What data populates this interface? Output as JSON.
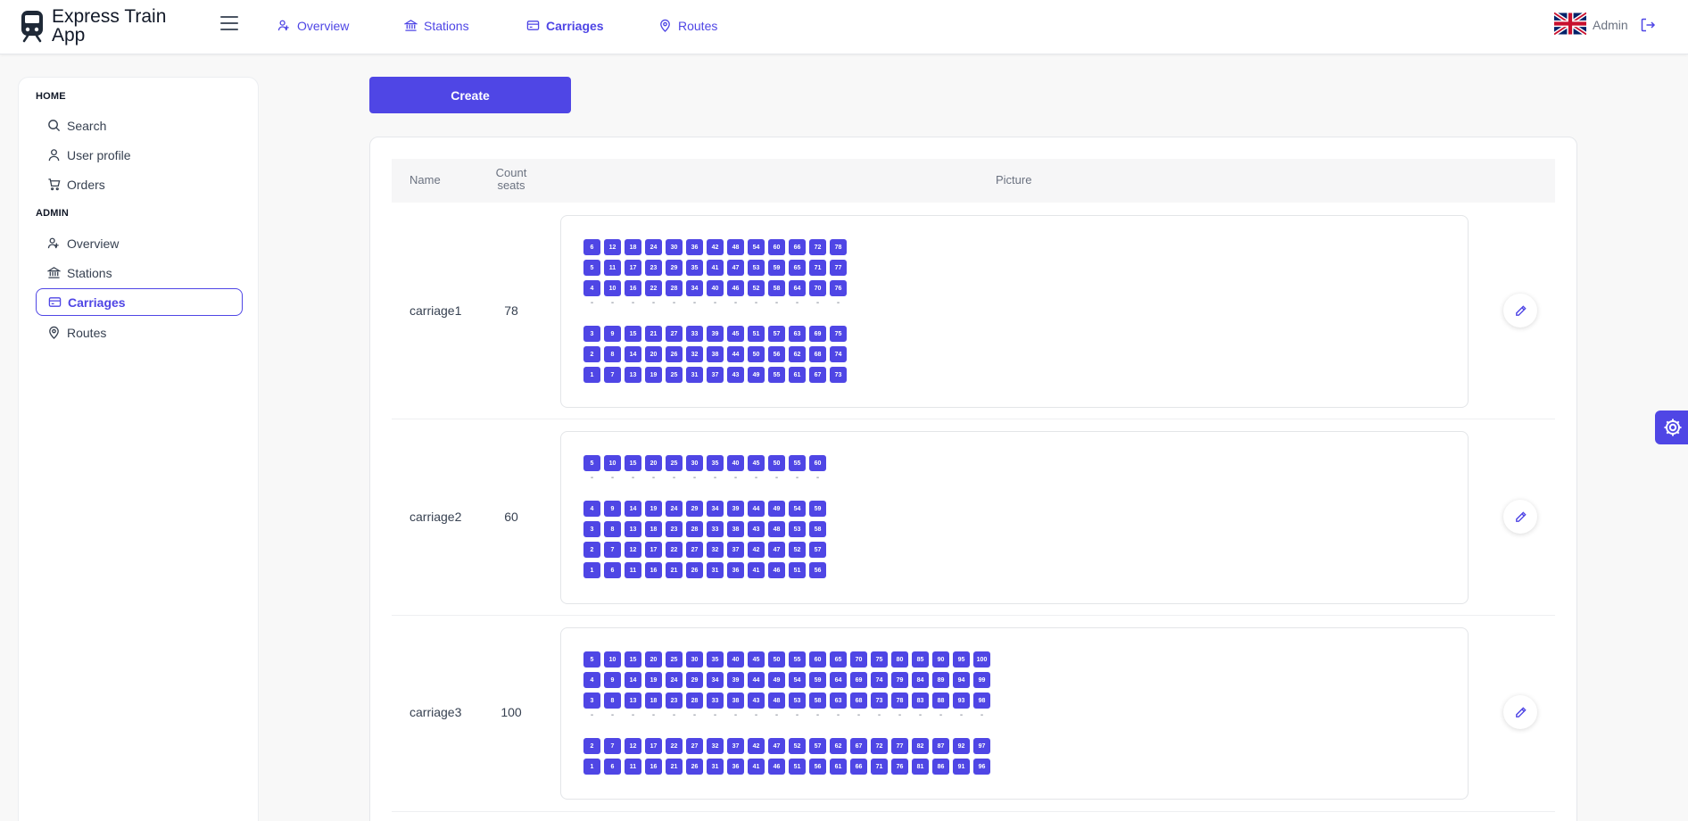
{
  "app": {
    "title": "Express Train App",
    "user": "Admin"
  },
  "nav": {
    "overview": "Overview",
    "stations": "Stations",
    "carriages": "Carriages",
    "routes": "Routes"
  },
  "sidebar": {
    "home_heading": "HOME",
    "search": "Search",
    "user_profile": "User profile",
    "orders": "Orders",
    "admin_heading": "ADMIN",
    "overview": "Overview",
    "stations": "Stations",
    "carriages": "Carriages",
    "routes": "Routes"
  },
  "main": {
    "create_label": "Create"
  },
  "table": {
    "columns": {
      "name": "Name",
      "count": "Count seats",
      "picture": "Picture"
    },
    "rows": [
      {
        "name": "carriage1",
        "count": "78",
        "seats_above": [
          [
            "6",
            "12",
            "18",
            "24",
            "30",
            "36",
            "42",
            "48",
            "54",
            "60",
            "66",
            "72",
            "78"
          ],
          [
            "5",
            "11",
            "17",
            "23",
            "29",
            "35",
            "41",
            "47",
            "53",
            "59",
            "65",
            "71",
            "77"
          ],
          [
            "4",
            "10",
            "16",
            "22",
            "28",
            "34",
            "40",
            "46",
            "52",
            "58",
            "64",
            "70",
            "76"
          ]
        ],
        "seats_below": [
          [
            "3",
            "9",
            "15",
            "21",
            "27",
            "33",
            "39",
            "45",
            "51",
            "57",
            "63",
            "69",
            "75"
          ],
          [
            "2",
            "8",
            "14",
            "20",
            "26",
            "32",
            "38",
            "44",
            "50",
            "56",
            "62",
            "68",
            "74"
          ],
          [
            "1",
            "7",
            "13",
            "19",
            "25",
            "31",
            "37",
            "43",
            "49",
            "55",
            "61",
            "67",
            "73"
          ]
        ]
      },
      {
        "name": "carriage2",
        "count": "60",
        "seats_above": [
          [
            "5",
            "10",
            "15",
            "20",
            "25",
            "30",
            "35",
            "40",
            "45",
            "50",
            "55",
            "60"
          ]
        ],
        "seats_below": [
          [
            "4",
            "9",
            "14",
            "19",
            "24",
            "29",
            "34",
            "39",
            "44",
            "49",
            "54",
            "59"
          ],
          [
            "3",
            "8",
            "13",
            "18",
            "23",
            "28",
            "33",
            "38",
            "43",
            "48",
            "53",
            "58"
          ],
          [
            "2",
            "7",
            "12",
            "17",
            "22",
            "27",
            "32",
            "37",
            "42",
            "47",
            "52",
            "57"
          ],
          [
            "1",
            "6",
            "11",
            "16",
            "21",
            "26",
            "31",
            "36",
            "41",
            "46",
            "51",
            "56"
          ]
        ]
      },
      {
        "name": "carriage3",
        "count": "100",
        "seats_above": [
          [
            "5",
            "10",
            "15",
            "20",
            "25",
            "30",
            "35",
            "40",
            "45",
            "50",
            "55",
            "60",
            "65",
            "70",
            "75",
            "80",
            "85",
            "90",
            "95",
            "100"
          ],
          [
            "4",
            "9",
            "14",
            "19",
            "24",
            "29",
            "34",
            "39",
            "44",
            "49",
            "54",
            "59",
            "64",
            "69",
            "74",
            "79",
            "84",
            "89",
            "94",
            "99"
          ],
          [
            "3",
            "8",
            "13",
            "18",
            "23",
            "28",
            "33",
            "38",
            "43",
            "48",
            "53",
            "58",
            "63",
            "68",
            "73",
            "78",
            "83",
            "88",
            "93",
            "98"
          ]
        ],
        "seats_below": [
          [
            "2",
            "7",
            "12",
            "17",
            "22",
            "27",
            "32",
            "37",
            "42",
            "47",
            "52",
            "57",
            "62",
            "67",
            "72",
            "77",
            "82",
            "87",
            "92",
            "97"
          ],
          [
            "1",
            "6",
            "11",
            "16",
            "21",
            "26",
            "31",
            "36",
            "41",
            "46",
            "51",
            "56",
            "61",
            "66",
            "71",
            "76",
            "81",
            "86",
            "91",
            "96"
          ]
        ]
      }
    ]
  },
  "colors": {
    "accent": "#4f46e5"
  },
  "icons": [
    "train-icon",
    "hamburger-icon",
    "user-group-icon",
    "bank-icon",
    "card-icon",
    "map-pin-icon",
    "uk-flag-icon",
    "logout-icon",
    "search-icon",
    "user-icon",
    "cart-icon",
    "pencil-icon",
    "gear-icon"
  ]
}
